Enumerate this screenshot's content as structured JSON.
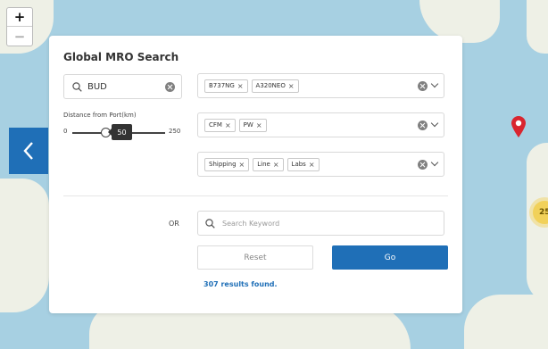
{
  "map": {
    "zoom_in_label": "+",
    "zoom_out_label": "−",
    "side_tab_icon": "chevron-left-icon",
    "marker_icon": "map-pin-icon",
    "marker_color": "#d9252f",
    "cluster_count": "25",
    "cluster_color": "#f1d15a",
    "water_color": "#a7d0e2",
    "land_color": "#eef0e6"
  },
  "search": {
    "title": "Global MRO Search",
    "port_input": {
      "value": "BUD",
      "icon": "search-icon"
    },
    "distance": {
      "label": "Distance from Port(km)",
      "min": "0",
      "max": "250",
      "value": "50",
      "value_fraction": 0.2
    },
    "aircraft_tags": [
      {
        "label": "B737NG"
      },
      {
        "label": "A320NEO"
      }
    ],
    "engine_tags": [
      {
        "label": "CFM"
      },
      {
        "label": "PW"
      }
    ],
    "service_tags": [
      {
        "label": "Shipping"
      },
      {
        "label": "Line"
      },
      {
        "label": "Labs"
      }
    ],
    "tag_remove_glyph": "×",
    "or_label": "OR",
    "keyword_placeholder": "Search Keyword",
    "reset_label": "Reset",
    "go_label": "Go",
    "results_text": "307 results found.",
    "accent_color": "#1f6fb7"
  }
}
